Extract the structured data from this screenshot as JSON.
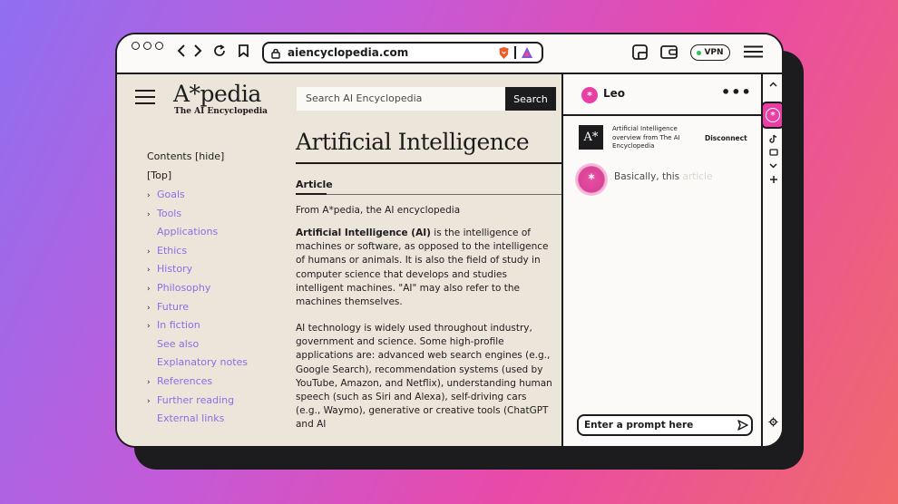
{
  "browser": {
    "url": "aiencyclopedia.com",
    "vpn_label": "VPN",
    "traffic_lights": [
      "close",
      "minimize",
      "maximize"
    ]
  },
  "site": {
    "logo": "A*pedia",
    "tagline": "The AI Encyclopedia",
    "search_placeholder": "Search AI Encyclopedia",
    "search_button": "Search"
  },
  "toc": {
    "header": "Contents [hide]",
    "top": "[Top]",
    "items": [
      {
        "label": "Goals",
        "expandable": true
      },
      {
        "label": "Tools",
        "expandable": true
      },
      {
        "label": "Applications",
        "expandable": false
      },
      {
        "label": "Ethics",
        "expandable": true
      },
      {
        "label": "History",
        "expandable": true
      },
      {
        "label": "Philosophy",
        "expandable": true
      },
      {
        "label": "Future",
        "expandable": true
      },
      {
        "label": "In fiction",
        "expandable": true
      },
      {
        "label": "See also",
        "expandable": false
      },
      {
        "label": "Explanatory notes",
        "expandable": false
      },
      {
        "label": "References",
        "expandable": true
      },
      {
        "label": "Further reading",
        "expandable": true
      },
      {
        "label": "External links",
        "expandable": false
      }
    ]
  },
  "article": {
    "title": "Artificial Intelligence",
    "tab": "Article",
    "from": "From A*pedia, the AI encyclopedia",
    "para1_bold": "Artificial Intelligence (AI)",
    "para1_rest": " is the intelligence of machines or software, as opposed to the intelligence of humans or animals. It is also the field of study in computer science that develops and studies intelligent machines. \"AI\" may also refer to the machines themselves.",
    "para2": "AI technology is widely used throughout industry, government and science. Some high-profile applications are: advanced web search engines (e.g., Google Search), recommendation systems (used by YouTube, Amazon, and Netflix), understanding human speech (such as Siri and Alexa), self-driving cars (e.g., Waymo), generative or creative tools (ChatGPT and AI"
  },
  "leo": {
    "name": "Leo",
    "menu": "•••",
    "context_title": "Artificial Intelligence overview from The AI Encyclopedia",
    "context_logo": "A*",
    "disconnect": "Disconnect",
    "reply_visible": "Basically, this ",
    "reply_faded": "article",
    "prompt_placeholder": "Enter a prompt here"
  },
  "colors": {
    "accent": "#e83fa5",
    "link": "#8b6ee8",
    "page_bg": "#ece5da",
    "ink": "#1c1c1e"
  }
}
